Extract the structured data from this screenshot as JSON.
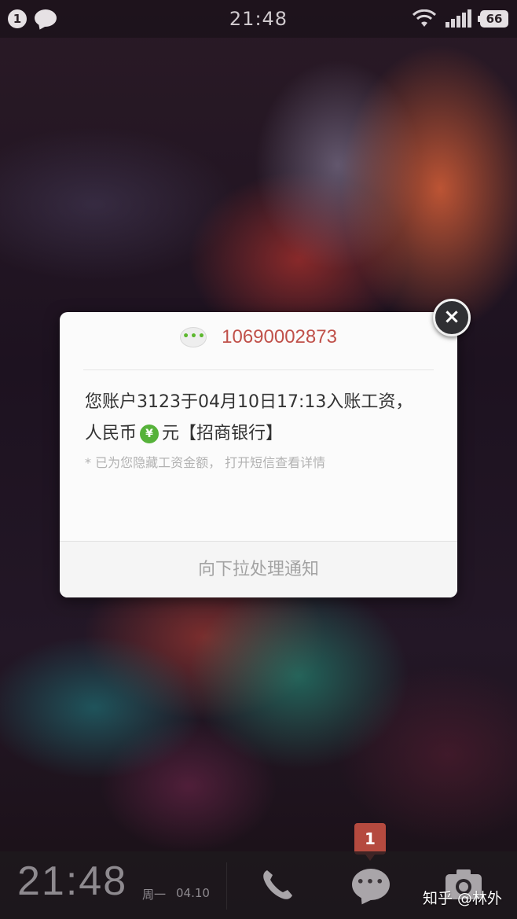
{
  "status_bar": {
    "notification_count": "1",
    "time": "21:48",
    "battery": "66",
    "icons": [
      "message-icon",
      "wifi-icon",
      "signal-icon",
      "battery-icon"
    ]
  },
  "notification": {
    "sender": "10690002873",
    "message_line1": "您账户3123于04月10日17:13入账工资，",
    "message_line2_prefix": "人民币",
    "currency_symbol": "¥",
    "message_line2_suffix": "元【招商银行】",
    "hint": "* 已为您隐藏工资金额， 打开短信查看详情",
    "pull_action": "向下拉处理通知",
    "close_glyph": "×"
  },
  "dock": {
    "time": "21:48",
    "weekday": "周一",
    "date": "04.10",
    "message_badge": "1"
  },
  "watermark": "知乎 @林外",
  "colors": {
    "sender": "#c0514a",
    "currency_badge": "#56b23a",
    "message_badge": "#b54a3f"
  }
}
